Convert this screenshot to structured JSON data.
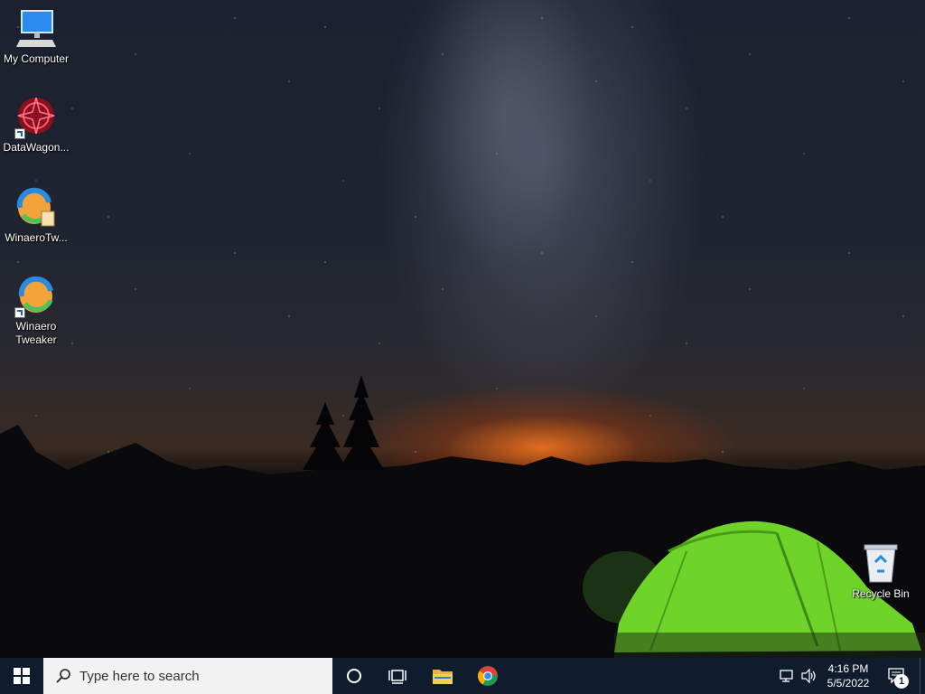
{
  "desktop": {
    "icons": [
      {
        "label": "My Computer",
        "icon": "computer-icon"
      },
      {
        "label": "DataWagon...",
        "icon": "datawagon-icon"
      },
      {
        "label": "WinaeroTw...",
        "icon": "winaero-tweaker-icon"
      },
      {
        "label": "Winaero Tweaker",
        "icon": "winaero-tweaker-icon"
      },
      {
        "label": "Recycle Bin",
        "icon": "recycle-bin-icon"
      }
    ]
  },
  "taskbar": {
    "search_placeholder": "Type here to search",
    "pinned": [
      {
        "name": "cortana",
        "icon": "circle-icon"
      },
      {
        "name": "task-view",
        "icon": "task-view-icon"
      },
      {
        "name": "file-explorer",
        "icon": "folder-icon"
      },
      {
        "name": "chrome",
        "icon": "chrome-icon"
      }
    ],
    "clock": {
      "time": "4:16 PM",
      "date": "5/5/2022"
    },
    "notification_count": "1",
    "accent": "#0e1c2e"
  }
}
